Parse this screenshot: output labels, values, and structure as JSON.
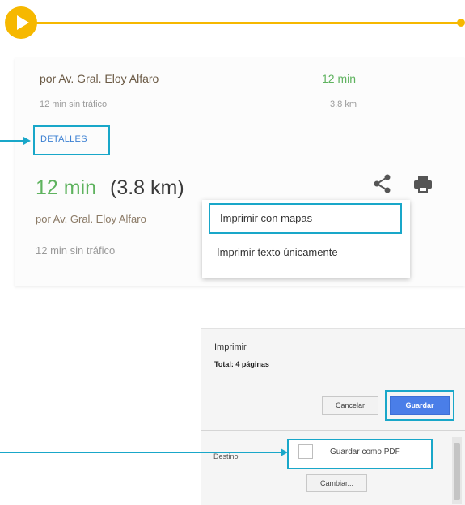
{
  "colors": {
    "accent_yellow": "#f6b800",
    "callout_blue": "#19a7c9",
    "time_green": "#5fb35f",
    "link_blue": "#3a7fd2",
    "primary_button": "#4a7ee8"
  },
  "route_summary": {
    "via": "por Av. Gral. Eloy Alfaro",
    "time": "12 min",
    "traffic_note": "12 min sin tráfico",
    "distance": "3.8 km",
    "details_link": "DETALLES"
  },
  "route_detail": {
    "time": "12 min",
    "distance": "(3.8 km)",
    "via": "por Av. Gral. Eloy Alfaro",
    "traffic_note": "12 min sin tráfico",
    "share_icon": "share-icon",
    "print_icon": "print-icon"
  },
  "print_menu": {
    "items": [
      {
        "label": "Imprimir con mapas",
        "highlighted": true
      },
      {
        "label": "Imprimir texto únicamente",
        "highlighted": false
      }
    ]
  },
  "print_dialog": {
    "title": "Imprimir",
    "total": "Total: 4 páginas",
    "cancel_label": "Cancelar",
    "save_label": "Guardar",
    "destination_label": "Destino",
    "destination_value": "Guardar como PDF",
    "change_label": "Cambiar..."
  }
}
